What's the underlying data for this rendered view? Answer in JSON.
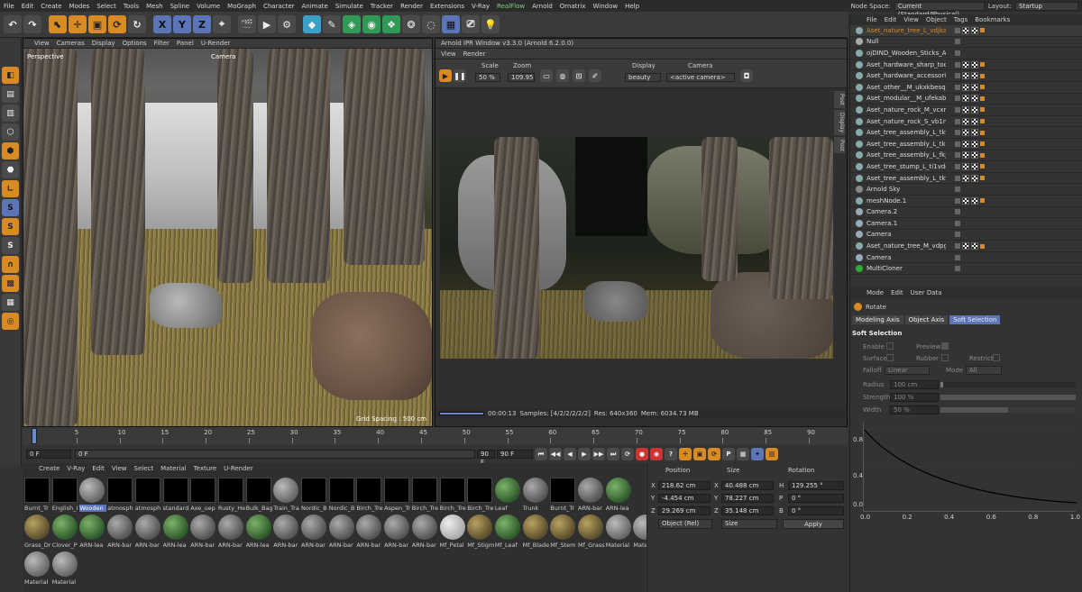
{
  "menubar": {
    "items": [
      "File",
      "Edit",
      "Create",
      "Modes",
      "Select",
      "Tools",
      "Mesh",
      "Spline",
      "Volume",
      "MoGraph",
      "Character",
      "Animate",
      "Simulate",
      "Tracker",
      "Render",
      "Extensions",
      "V-Ray",
      "RealFlow",
      "Arnold",
      "Ornatrix",
      "Window",
      "Help"
    ],
    "node_space_label": "Node Space:",
    "node_space_value": "Current (Standard/Physical)",
    "layout_label": "Layout:",
    "layout_value": "Startup"
  },
  "viewport": {
    "menu": [
      "View",
      "Cameras",
      "Display",
      "Options",
      "Filter",
      "Panel",
      "U-Render"
    ],
    "perspective": "Perspective",
    "camera": "Camera",
    "grid_spacing": "Grid Spacing : 500 cm"
  },
  "ipr": {
    "title": "Arnold IPR Window v3.3.0 (Arnold 6.2.0.0)",
    "menu": [
      "View",
      "Render"
    ],
    "scale_label": "Scale",
    "scale_value": "50 %",
    "zoom_label": "Zoom",
    "zoom_value": "109.95",
    "display_label": "Display",
    "display_value": "beauty",
    "camera_label": "Camera",
    "camera_value": "<active camera>",
    "side_tabs": [
      "Post",
      "Display",
      "Post"
    ],
    "status": {
      "time": "00:00:13",
      "samples": "Samples: [4/2/2/2/2/2]",
      "res": "Res: 640x360",
      "mem": "Mem: 6034.73 MB"
    }
  },
  "object_manager": {
    "menu": [
      "File",
      "Edit",
      "View",
      "Object",
      "Tags",
      "Bookmarks"
    ],
    "rows": [
      "Aset_nature_tree_L_vdjkabpq",
      "Null",
      "ojDIND_Wooden_Sticks_Anc",
      "Aset_hardware_sharp_tools_",
      "Aset_hardware_accessories_",
      "Aset_other__M_ukxkbesqa_L",
      "Aset_modular__M_ufekab3d",
      "Aset_nature_rock_M_vcxmcj",
      "Aset_nature_rock_S_vb1mciv",
      "Aset_tree_assembly_L_tkyqa",
      "Aset_tree_assembly_L_tk3tbl",
      "Aset_tree_assembly_L_fkjpbl",
      "Aset_tree_stump_L_ti1vdc2d",
      "Aset_tree_assembly_L_tkyqa",
      "Arnold Sky",
      "meshNode.1",
      "Camera.2",
      "Camera.1",
      "Camera",
      "Aset_nature_tree_M_vdpgbh",
      "Camera",
      "MultiCloner"
    ],
    "side_tabs": [
      "Objects",
      "Takes",
      "Content Browser"
    ]
  },
  "attributes": {
    "menu": [
      "Mode",
      "Edit",
      "User Data"
    ],
    "tool": "Rotate",
    "tabs": [
      "Modeling Axis",
      "Object Axis",
      "Soft Selection"
    ],
    "section": "Soft Selection",
    "enable": "Enable",
    "preview": "Preview",
    "surface": "Surface",
    "rubber": "Rubber",
    "restrict": "Restrict",
    "falloff_label": "Falloff",
    "falloff_value": "Linear",
    "mode_label": "Mode",
    "mode_value": "All",
    "radius_label": "Radius",
    "radius_value": "100 cm",
    "strength_label": "Strength",
    "strength_value": "100 %",
    "width_label": "Width",
    "width_value": "50 %",
    "graph_y": [
      "0.8",
      "0.4",
      "0.0"
    ],
    "graph_x": [
      "0.0",
      "0.2",
      "0.4",
      "0.6",
      "0.8",
      "1.0"
    ],
    "side_tabs": [
      "Attributes",
      "Layers",
      "Structure"
    ]
  },
  "timeline": {
    "ticks": [
      "0",
      "5",
      "10",
      "15",
      "20",
      "25",
      "30",
      "35",
      "40",
      "45",
      "50",
      "55",
      "60",
      "65",
      "70",
      "75",
      "80",
      "85",
      "90"
    ],
    "current": "0 F"
  },
  "transport": {
    "start": "0 F",
    "current": "0 F",
    "end": "90 F",
    "end2": "90 F"
  },
  "materials": {
    "menu": [
      "Create",
      "V-Ray",
      "Edit",
      "View",
      "Select",
      "Material",
      "Texture",
      "U-Render"
    ],
    "rows": [
      [
        "Burnt_Tr",
        "English_I",
        "Wooden",
        "atmosph",
        "atmosph",
        "standard",
        "Axe_uep",
        "Rusty_He",
        "Bulk_Bag",
        "Train_Tra",
        "Nordic_B",
        "Nordic_B",
        "Birch_Tre",
        "Aspen_Tr",
        "Birch_Tre",
        "Birch_Tre",
        "Birch_Tre",
        "Leaf",
        "Trunk",
        "Burnt_Tr",
        "ARN-bar",
        "ARN-lea"
      ],
      [
        "Grass_Dr",
        "Clover_P",
        "ARN-lea",
        "ARN-bar",
        "ARN-bar",
        "ARN-lea",
        "ARN-bar",
        "ARN-bar",
        "ARN-lea",
        "ARN-bar",
        "ARN-bar",
        "ARN-bar",
        "ARN-bar",
        "ARN-bar",
        "ARN-bar",
        "Mf_Petal",
        "Mf_Stigm",
        "Mf_Leaf",
        "Mf_Blade",
        "Mf_Stem",
        "Mf_Grass",
        "Material",
        "Material"
      ],
      [
        "Material",
        "Material"
      ]
    ]
  },
  "coords": {
    "position_label": "Position",
    "size_label": "Size",
    "rotation_label": "Rotation",
    "x": "218.62 cm",
    "y": "-4.454 cm",
    "z": "29.269 cm",
    "sx": "40.488 cm",
    "sy": "78.227 cm",
    "sz": "35.148 cm",
    "h": "129.255 °",
    "p": "0 °",
    "b": "0 °",
    "mode1": "Object (Rel)",
    "mode2": "Size",
    "apply": "Apply"
  },
  "colors": {
    "accent": "#d88a25",
    "blue": "#5c74b8",
    "green": "#7fd27f"
  }
}
